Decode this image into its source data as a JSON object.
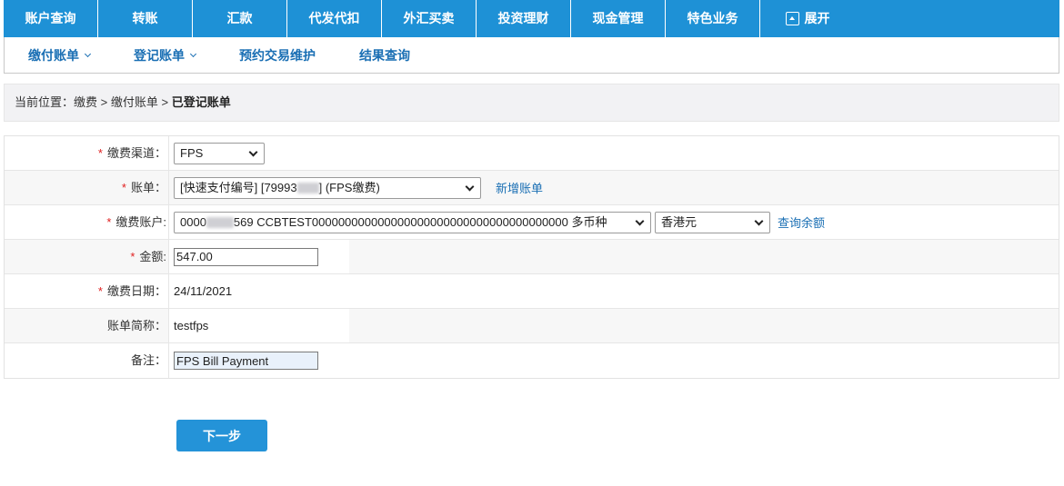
{
  "topnav": {
    "items": [
      {
        "label": "账户查询",
        "icon": ""
      },
      {
        "label": "转账",
        "icon": ""
      },
      {
        "label": "汇款",
        "icon": ""
      },
      {
        "label": "代发代扣",
        "icon": ""
      },
      {
        "label": "外汇买卖",
        "icon": ""
      },
      {
        "label": "投资理财",
        "icon": ""
      },
      {
        "label": "现金管理",
        "icon": ""
      },
      {
        "label": "特色业务",
        "icon": ""
      },
      {
        "label": "展开",
        "icon": "expand-icon"
      }
    ],
    "color": "#1e91d6"
  },
  "subnav": {
    "items": [
      {
        "label": "缴付账单",
        "has_dropdown": true
      },
      {
        "label": "登记账单",
        "has_dropdown": true
      },
      {
        "label": "预约交易维护",
        "has_dropdown": false
      },
      {
        "label": "结果查询",
        "has_dropdown": false
      }
    ],
    "color": "#1a6fb4"
  },
  "breadcrumb": {
    "prefix": "当前位置：",
    "path1": "缴费",
    "sep1": " > ",
    "path2": "缴付账单",
    "sep2": " > ",
    "current": "已登记账单"
  },
  "form": {
    "channel": {
      "label": "缴费渠道：",
      "value": "FPS"
    },
    "bill": {
      "label": "账单：",
      "value_prefix": "[快速支付编号] [79993",
      "value_suffix": "] (FPS缴费)",
      "link": "新增账单"
    },
    "account": {
      "label": "缴费账户:",
      "value_prefix": "0000",
      "value_suffix": "569 CCBTEST000000000000000000000000000000000000000 多币种",
      "currency": "香港元",
      "link": "查询余额"
    },
    "amount": {
      "label": "金额:",
      "value": "547.00"
    },
    "date": {
      "label": "缴费日期：",
      "value": "24/11/2021"
    },
    "nickname": {
      "label": "账单简称：",
      "value": "testfps"
    },
    "remark": {
      "label": "备注：",
      "value": "FPS Bill Payment"
    },
    "required_mark": "*"
  },
  "actions": {
    "next_label": "下一步",
    "color": "#2493d8"
  }
}
